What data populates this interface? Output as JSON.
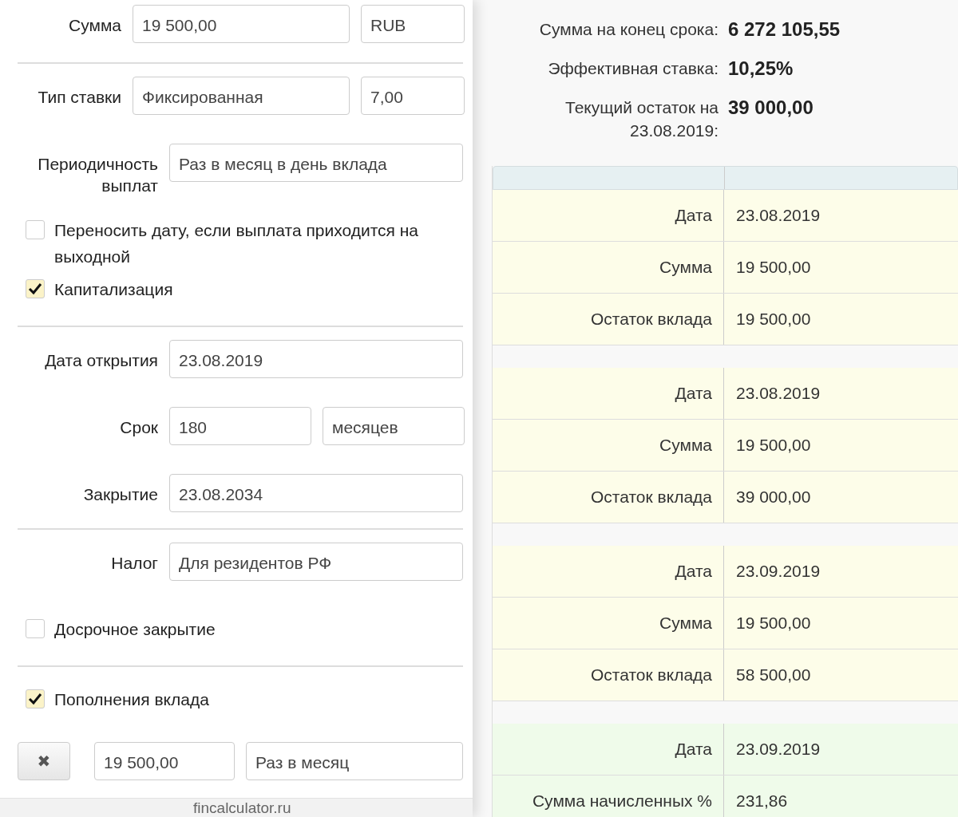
{
  "form": {
    "rows": [
      {
        "kind": "amount",
        "label": "Сумма",
        "fields": [
          "19 500,00",
          "RUB"
        ],
        "divider": true
      },
      {
        "kind": "amount",
        "label": "Тип ставки",
        "fields": [
          "Фиксированная",
          "7,00"
        ],
        "divider": false
      },
      {
        "kind": "single",
        "label": "Периодичность выплат",
        "fields": [
          "Раз в месяц в день вклада"
        ],
        "divider": false
      },
      {
        "kind": "checkbox",
        "label": "Переносить дату, если выплата приходится на выходной",
        "checked": false,
        "divider": false
      },
      {
        "kind": "checkbox",
        "label": "Капитализация",
        "checked": true,
        "divider": true
      },
      {
        "kind": "single",
        "label": "Дата открытия",
        "fields": [
          "23.08.2019"
        ],
        "divider": false
      },
      {
        "kind": "term",
        "label": "Срок",
        "fields": [
          "180",
          "месяцев"
        ],
        "divider": false
      },
      {
        "kind": "single",
        "label": "Закрытие",
        "fields": [
          "23.08.2034"
        ],
        "divider": true
      },
      {
        "kind": "single",
        "label": "Налог",
        "fields": [
          "Для резидентов РФ"
        ],
        "divider": false
      },
      {
        "kind": "checkbox",
        "label": "Досрочное закрытие",
        "checked": false,
        "divider": true
      },
      {
        "kind": "checkbox",
        "label": "Пополнения вклада",
        "checked": true,
        "divider": false
      },
      {
        "kind": "replenishment",
        "remove": "✖",
        "fields": [
          "19 500,00",
          "Раз в месяц"
        ],
        "divider": false
      }
    ],
    "footer": "fincalculator.ru"
  },
  "summary": [
    {
      "label": "Сумма на конец срока:",
      "value": "6 272 105,55"
    },
    {
      "label": "Эффективная ставка:",
      "value": "10,25%"
    },
    {
      "label": "Текущий остаток на 23.08.2019:",
      "value": "39 000,00"
    }
  ],
  "schedule": {
    "groups": [
      {
        "color": "#fdfde9",
        "rows": [
          {
            "label": "Дата",
            "value": "23.08.2019"
          },
          {
            "label": "Сумма",
            "value": "19 500,00"
          },
          {
            "label": "Остаток вклада",
            "value": "19 500,00"
          }
        ]
      },
      {
        "color": "#fdfde9",
        "rows": [
          {
            "label": "Дата",
            "value": "23.08.2019"
          },
          {
            "label": "Сумма",
            "value": "19 500,00"
          },
          {
            "label": "Остаток вклада",
            "value": "39 000,00"
          }
        ]
      },
      {
        "color": "#fdfde9",
        "rows": [
          {
            "label": "Дата",
            "value": "23.09.2019"
          },
          {
            "label": "Сумма",
            "value": "19 500,00"
          },
          {
            "label": "Остаток вклада",
            "value": "58 500,00"
          }
        ]
      },
      {
        "color": "#effbea",
        "rows": [
          {
            "label": "Дата",
            "value": "23.09.2019"
          },
          {
            "label": "Сумма начисленных %",
            "value": "231,86"
          }
        ]
      }
    ]
  }
}
